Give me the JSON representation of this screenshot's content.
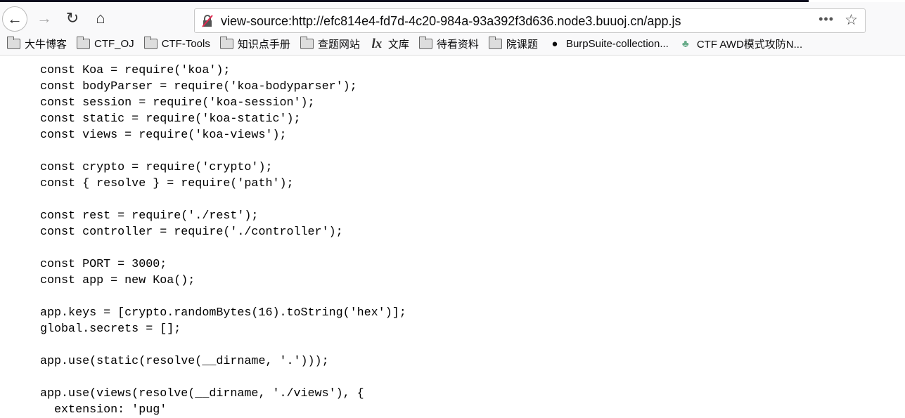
{
  "browser": {
    "url": "view-source:http://efc814e4-fd7d-4c20-984a-93a392f3d636.node3.buuoj.cn/app.js",
    "more_label": "•••"
  },
  "bookmarks": [
    {
      "label": "大牛博客",
      "icon": "folder-icon"
    },
    {
      "label": "CTF_OJ",
      "icon": "folder-icon"
    },
    {
      "label": "CTF-Tools",
      "icon": "folder-icon"
    },
    {
      "label": "知识点手册",
      "icon": "folder-icon"
    },
    {
      "label": "查题网站",
      "icon": "folder-icon"
    },
    {
      "label": "文库",
      "icon": "lx-icon"
    },
    {
      "label": "待看资料",
      "icon": "folder-icon"
    },
    {
      "label": "院课题",
      "icon": "folder-icon"
    },
    {
      "label": "BurpSuite-collection...",
      "icon": "github-icon"
    },
    {
      "label": "CTF AWD模式攻防N...",
      "icon": "cactus-icon"
    }
  ],
  "source_lines": [
    "const Koa = require('koa');",
    "const bodyParser = require('koa-bodyparser');",
    "const session = require('koa-session');",
    "const static = require('koa-static');",
    "const views = require('koa-views');",
    "",
    "const crypto = require('crypto');",
    "const { resolve } = require('path');",
    "",
    "const rest = require('./rest');",
    "const controller = require('./controller');",
    "",
    "const PORT = 3000;",
    "const app = new Koa();",
    "",
    "app.keys = [crypto.randomBytes(16).toString('hex')];",
    "global.secrets = [];",
    "",
    "app.use(static(resolve(__dirname, '.')));",
    "",
    "app.use(views(resolve(__dirname, './views'), {",
    "  extension: 'pug'"
  ]
}
